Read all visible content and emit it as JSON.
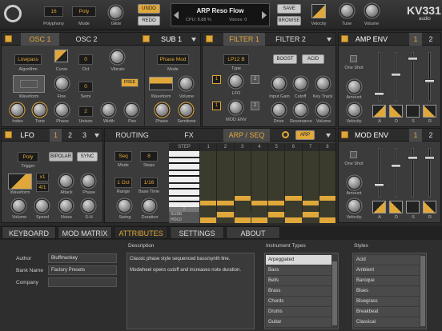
{
  "topbar": {
    "polyphony_value": "16",
    "polyphony_label": "Polyphony",
    "mode_value": "Poly",
    "mode_label": "Mode",
    "glide_label": "Glide",
    "undo": "UNDO",
    "redo": "REDO",
    "preset_name": "ARP Reso Flow",
    "cpu": "CPU: 8.88 %",
    "voices": "Voices: 0",
    "save": "SAVE",
    "browse": "BROWSE",
    "velocity": "Velocity",
    "tune": "Tune",
    "volume": "Volume",
    "brand": "KV331",
    "brand_sub": "audio"
  },
  "osc": {
    "tab1": "OSC 1",
    "tab2": "OSC 2",
    "sub": "SUB 1",
    "algorithm_value": "Lowpass",
    "algorithm": "Algorithm",
    "curve": "Curve",
    "oct_value": "0",
    "oct": "Oct",
    "vibrato": "Vibrato",
    "waveform": "Waveform",
    "fine": "Fine",
    "semi_value": "0",
    "semi": "Semi",
    "free": "FREE",
    "index": "Index",
    "tone": "Tone",
    "phase": "Phase",
    "unison_value": "2",
    "unison": "Unison",
    "width": "Width",
    "pan": "Pan"
  },
  "sub": {
    "mode_value": "Phase Mod",
    "mode": "Mode",
    "waveform": "Waveform",
    "volume": "Volume",
    "phase": "Phase",
    "semitone": "Semitone"
  },
  "filter": {
    "tab1": "FILTER 1",
    "tab2": "FILTER 2",
    "type_value": "LP12 B",
    "type": "Type",
    "boost": "BOOST",
    "acid": "ACID",
    "lfo": "LFO",
    "lfo_n1": "1",
    "lfo_n2": "2",
    "modenv": "MOD ENV",
    "modenv_n1": "1",
    "modenv_n2": "2",
    "input_gain": "Input Gain",
    "cutoff": "Cutoff",
    "key_track": "Key Track",
    "drive": "Drive",
    "resonance": "Resonance",
    "volume": "Volume"
  },
  "ampenv": {
    "title": "AMP ENV",
    "n1": "1",
    "n2": "2",
    "one_shot": "One Shot",
    "amount": "Amount",
    "velocity": "Velocity",
    "a": "A",
    "d": "D",
    "s": "S",
    "r": "R"
  },
  "lfo": {
    "title": "LFO",
    "n1": "1",
    "n2": "2",
    "n3": "3",
    "trigger_value": "Poly",
    "trigger": "Trigger",
    "bipolar": "BIPOLAR",
    "sync": "SYNC",
    "x_value": "x1",
    "div_value": "4/1",
    "waveform": "Waveform",
    "attack": "Attack",
    "phase": "Phase",
    "volume": "Volume",
    "speed": "Speed",
    "noise": "Noise",
    "sh": "S-H"
  },
  "mid": {
    "routing": "ROUTING",
    "fx": "FX",
    "arp": "ARP / SEQ",
    "arp_toggle": "ARP"
  },
  "seq": {
    "mode_value": "Seq",
    "mode": "Mode",
    "steps_value": "8",
    "steps": "Steps",
    "range_value": "1 Oct",
    "range": "Range",
    "base_time_value": "1/16",
    "base_time": "Base Time",
    "swing": "Swing",
    "duration": "Duration",
    "step": "STEP",
    "cols": [
      "1",
      "2",
      "3",
      "4",
      "5",
      "6",
      "7",
      "8"
    ],
    "slide": "SLIDE",
    "hold": "HOLD",
    "zero": "0",
    "notes": [
      0.1,
      0.1,
      0.18,
      0.1,
      0.1,
      0.18,
      0.1,
      0.18
    ],
    "slides": [
      0,
      1,
      0,
      0,
      1,
      0,
      1,
      0
    ],
    "holds": [
      1,
      0,
      1,
      1,
      0,
      1,
      0,
      1
    ]
  },
  "modenv": {
    "title": "MOD ENV",
    "n1": "1",
    "n2": "2",
    "one_shot": "One Shot",
    "amount": "Amount",
    "velocity": "Velocity",
    "a": "A",
    "d": "D",
    "s": "S",
    "r": "R"
  },
  "bottom_tabs": {
    "keyboard": "KEYBOARD",
    "mod_matrix": "MOD MATRIX",
    "attributes": "ATTRIBUTES",
    "settings": "SETTINGS",
    "about": "ABOUT"
  },
  "attributes": {
    "author_label": "Author",
    "author": "Bluffmunkey",
    "bank_label": "Bank Name",
    "bank": "Factory Presets",
    "company_label": "Company",
    "company": "",
    "description_label": "Description",
    "description_1": "Classic phase style sequenced bass/synth line.",
    "description_2": "Modwheel opens cutoff and increases note duration.",
    "types_label": "Instrument Types",
    "types": [
      "Arpeggiated",
      "Bass",
      "Bells",
      "Brass",
      "Chords",
      "Drums",
      "Guitar"
    ],
    "styles_label": "Styles",
    "styles": [
      "Acid",
      "Ambient",
      "Baroque",
      "Blues",
      "Bluegrass",
      "Breakbeat",
      "Classical"
    ]
  },
  "colors": {
    "accent": "#e0a83a",
    "bg": "#2a2a2a"
  }
}
